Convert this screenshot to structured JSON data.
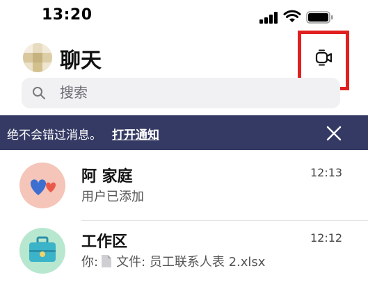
{
  "status_bar": {
    "time": "13:20",
    "signal_icon": "cellular-signal-icon",
    "wifi_icon": "wifi-icon",
    "battery_icon": "battery-icon"
  },
  "header": {
    "title": "聊天",
    "meet_icon": "video-meet-icon",
    "highlight_color": "#e02020"
  },
  "search": {
    "placeholder": "搜索",
    "icon": "search-icon"
  },
  "notice": {
    "text": "绝不会错过消息。",
    "link": "打开通知",
    "close_icon": "close-icon",
    "background": "#343a63"
  },
  "chats": [
    {
      "name": "阿 家庭",
      "time": "12:13",
      "preview": "用户已添加",
      "avatar_icon": "hearts-icon",
      "avatar_color": "#f4c5b8"
    },
    {
      "name": "工作区",
      "time": "12:12",
      "preview_prefix": "你:",
      "preview_file_icon": "file-icon",
      "preview": "文件: 员工联系人表 2.xlsx",
      "avatar_icon": "briefcase-icon",
      "avatar_color": "#b8e7d0"
    }
  ]
}
